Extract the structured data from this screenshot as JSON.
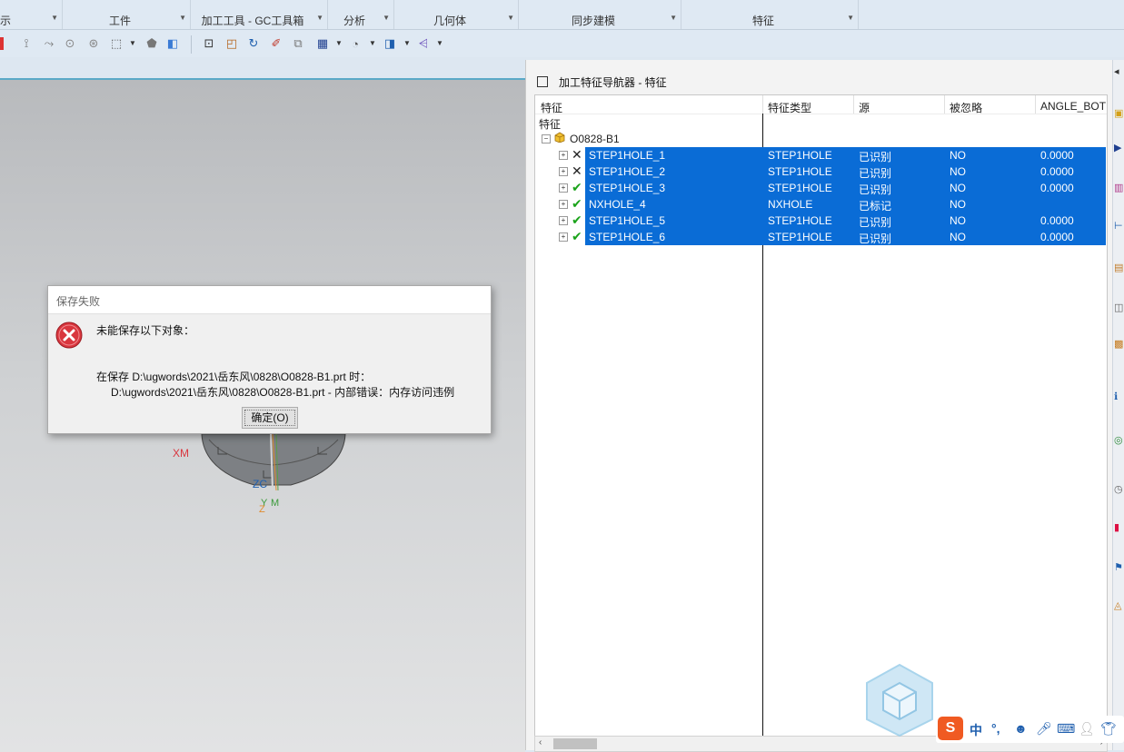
{
  "ribbon": {
    "groups": [
      {
        "label": "示"
      },
      {
        "label": "工件"
      },
      {
        "label": "加工工具 - GC工具箱"
      },
      {
        "label": "分析"
      },
      {
        "label": "几何体"
      },
      {
        "label": "同步建模"
      },
      {
        "label": "特征"
      }
    ]
  },
  "navigator": {
    "title": "加工特征导航器 - 特征",
    "columns": [
      "特征",
      "特征类型",
      "源",
      "被忽略",
      "ANGLE_BOT"
    ],
    "root_label": "特征",
    "part_name": "O0828-B1",
    "rows": [
      {
        "name": "STEP1HOLE_1",
        "status": "x",
        "type": "STEP1HOLE",
        "source": "已识别",
        "ignored": "NO",
        "angle": "0.0000"
      },
      {
        "name": "STEP1HOLE_2",
        "status": "x",
        "type": "STEP1HOLE",
        "source": "已识别",
        "ignored": "NO",
        "angle": "0.0000"
      },
      {
        "name": "STEP1HOLE_3",
        "status": "check",
        "type": "STEP1HOLE",
        "source": "已识别",
        "ignored": "NO",
        "angle": "0.0000"
      },
      {
        "name": "NXHOLE_4",
        "status": "check",
        "type": "NXHOLE",
        "source": "已标记",
        "ignored": "NO",
        "angle": ""
      },
      {
        "name": "STEP1HOLE_5",
        "status": "check",
        "type": "STEP1HOLE",
        "source": "已识别",
        "ignored": "NO",
        "angle": "0.0000"
      },
      {
        "name": "STEP1HOLE_6",
        "status": "check",
        "type": "STEP1HOLE",
        "source": "已识别",
        "ignored": "NO",
        "angle": "0.0000"
      }
    ]
  },
  "dialog": {
    "title": "保存失败",
    "message": "未能保存以下对象：",
    "detail_line1": "在保存 D:\\ugwords\\2021\\岳东风\\0828\\O0828-B1.prt 时：",
    "detail_line2": "D:\\ugwords\\2021\\岳东风\\0828\\O0828-B1.prt -  内部错误：内存访问违例",
    "ok_label": "确定(O)"
  },
  "graphics": {
    "axis_labels": {
      "xm": "XM",
      "zc": "ZC",
      "y": "Y",
      "m": "M",
      "z": "Z"
    }
  },
  "ime": {
    "lang": "中",
    "punct": "°,"
  },
  "colors": {
    "selection": "#0a6cd6",
    "accent_line": "#5aa9c7",
    "error": "#d9363e",
    "check": "#1aa31a"
  }
}
